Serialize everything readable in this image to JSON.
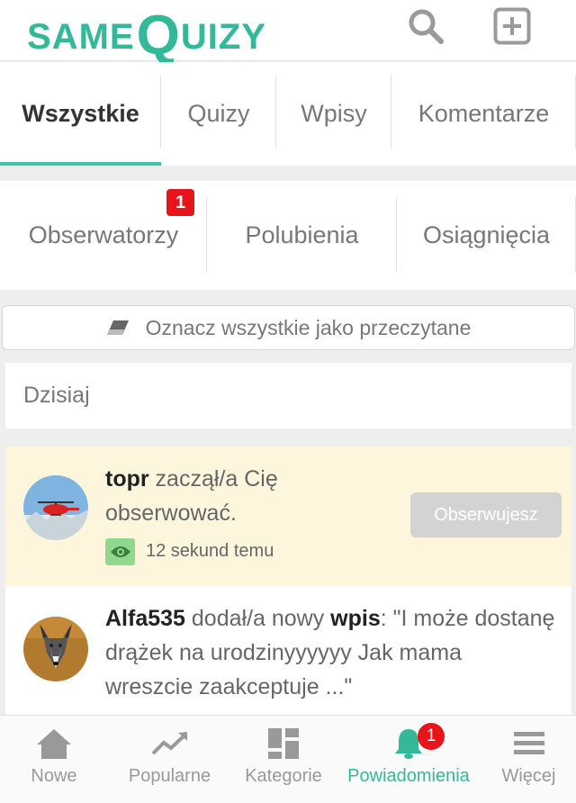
{
  "header": {
    "logo_same": "SAME",
    "logo_q": "Q",
    "logo_rest": "UIZY",
    "search_icon": "search-icon",
    "add_icon": "plus-square-icon",
    "brand_color": "#33b89a"
  },
  "tabs_primary": [
    {
      "label": "Wszystkie",
      "active": true
    },
    {
      "label": "Quizy",
      "active": false
    },
    {
      "label": "Wpisy",
      "active": false
    },
    {
      "label": "Komentarze",
      "active": false
    }
  ],
  "tabs_secondary": [
    {
      "label": "Obserwatorzy",
      "badge": "1"
    },
    {
      "label": "Polubienia"
    },
    {
      "label": "Osiągnięcia"
    }
  ],
  "mark_all_read": {
    "label": "Oznacz wszystkie jako przeczytane",
    "icon": "eraser-icon"
  },
  "section_title": "Dzisiaj",
  "notifications": [
    {
      "user": "topr",
      "text": " zaczął/a Cię obserwować.",
      "time": "12 sekund temu",
      "action_label": "Obserwujesz",
      "unread_bg": "#fdf6dc"
    },
    {
      "user": "Alfa535",
      "text_before": " dodał/a nowy ",
      "kind": "wpis",
      "text_after": ": \"I może dostanę drążek na urodzinyyyyyy Jak mama wreszcie zaakceptuje ...\""
    }
  ],
  "bottom_nav": [
    {
      "label": "Nowe",
      "icon": "home-icon",
      "active": false
    },
    {
      "label": "Popularne",
      "icon": "trending-icon",
      "active": false
    },
    {
      "label": "Kategorie",
      "icon": "grid-icon",
      "active": false
    },
    {
      "label": "Powiadomienia",
      "icon": "bell-icon",
      "active": true,
      "badge": "1"
    },
    {
      "label": "Więcej",
      "icon": "menu-icon",
      "active": false
    }
  ],
  "colors": {
    "accent": "#44c3a6",
    "badge": "#e8141c",
    "eye_badge": "#8fd98f"
  }
}
